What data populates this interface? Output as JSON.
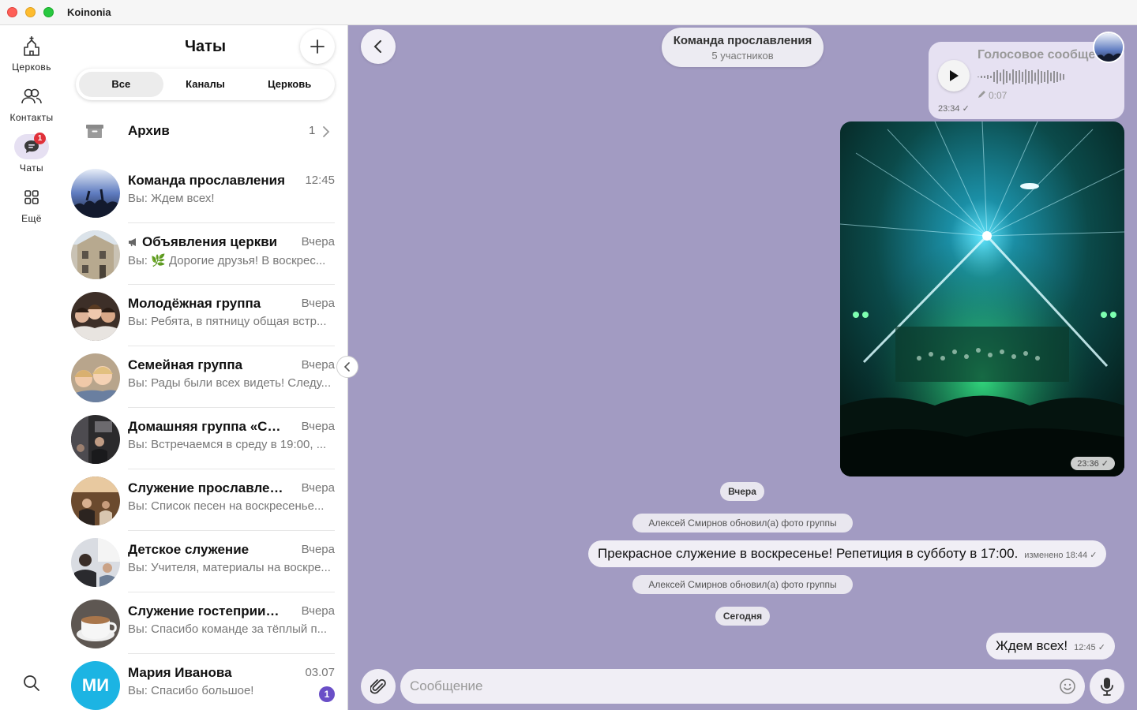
{
  "app": {
    "title": "Koinonia"
  },
  "rail": {
    "items": [
      {
        "label": "Церковь"
      },
      {
        "label": "Контакты"
      },
      {
        "label": "Чаты",
        "badge": "1"
      },
      {
        "label": "Ещё"
      }
    ]
  },
  "list": {
    "title": "Чаты",
    "tabs": [
      {
        "label": "Все"
      },
      {
        "label": "Каналы"
      },
      {
        "label": "Церковь"
      }
    ],
    "archive": {
      "label": "Архив",
      "count": "1"
    },
    "chats": [
      {
        "name": "Команда прославления",
        "time": "12:45",
        "message": "Вы: Ждем всех!"
      },
      {
        "name": "Объявления церкви",
        "time": "Вчера",
        "message": "Вы: 🌿 Дорогие друзья! В воскрес..."
      },
      {
        "name": "Молодёжная группа",
        "time": "Вчера",
        "message": "Вы: Ребята, в пятницу общая встр..."
      },
      {
        "name": "Семейная группа",
        "time": "Вчера",
        "message": "Вы: Рады были всех видеть! Следу..."
      },
      {
        "name": "Домашняя группа «Сев...",
        "time": "Вчера",
        "message": "Вы: Встречаемся в среду в 19:00, ..."
      },
      {
        "name": "Служение прославления",
        "time": "Вчера",
        "message": "Вы: Список песен на воскресенье..."
      },
      {
        "name": "Детское служение",
        "time": "Вчера",
        "message": "Вы: Учителя, материалы на воскре..."
      },
      {
        "name": "Служение гостеприимс...",
        "time": "Вчера",
        "message": "Вы: Спасибо команде за тёплый п..."
      },
      {
        "name": "Мария Иванова",
        "time": "03.07",
        "message": "Вы: Спасибо большое!",
        "initials": "МИ",
        "unread": "1"
      }
    ]
  },
  "chat": {
    "title": "Команда прославления",
    "subtitle": "5 участников",
    "voice": {
      "title": "Голосовое сообще",
      "duration": "0:07",
      "time": "23:34"
    },
    "photo": {
      "time": "23:36"
    },
    "day_yesterday": "Вчера",
    "system_1": "Алексей Смирнов обновил(а) фото группы",
    "message_1": {
      "text": "Прекрасное служение в воскресенье! Репетиция в субботу в 17:00.",
      "meta": "изменено 18:44"
    },
    "system_2": "Алексей Смирнов обновил(а) фото группы",
    "day_today": "Сегодня",
    "message_2": {
      "text": "Ждем всех!",
      "meta": "12:45"
    },
    "composer": {
      "placeholder": "Сообщение"
    }
  },
  "colors": {
    "chat_bg": "#a29bc2",
    "accent": "#6a4fc7",
    "badge_red": "#e0313a",
    "initials_avatar": "#1cb4e3"
  }
}
